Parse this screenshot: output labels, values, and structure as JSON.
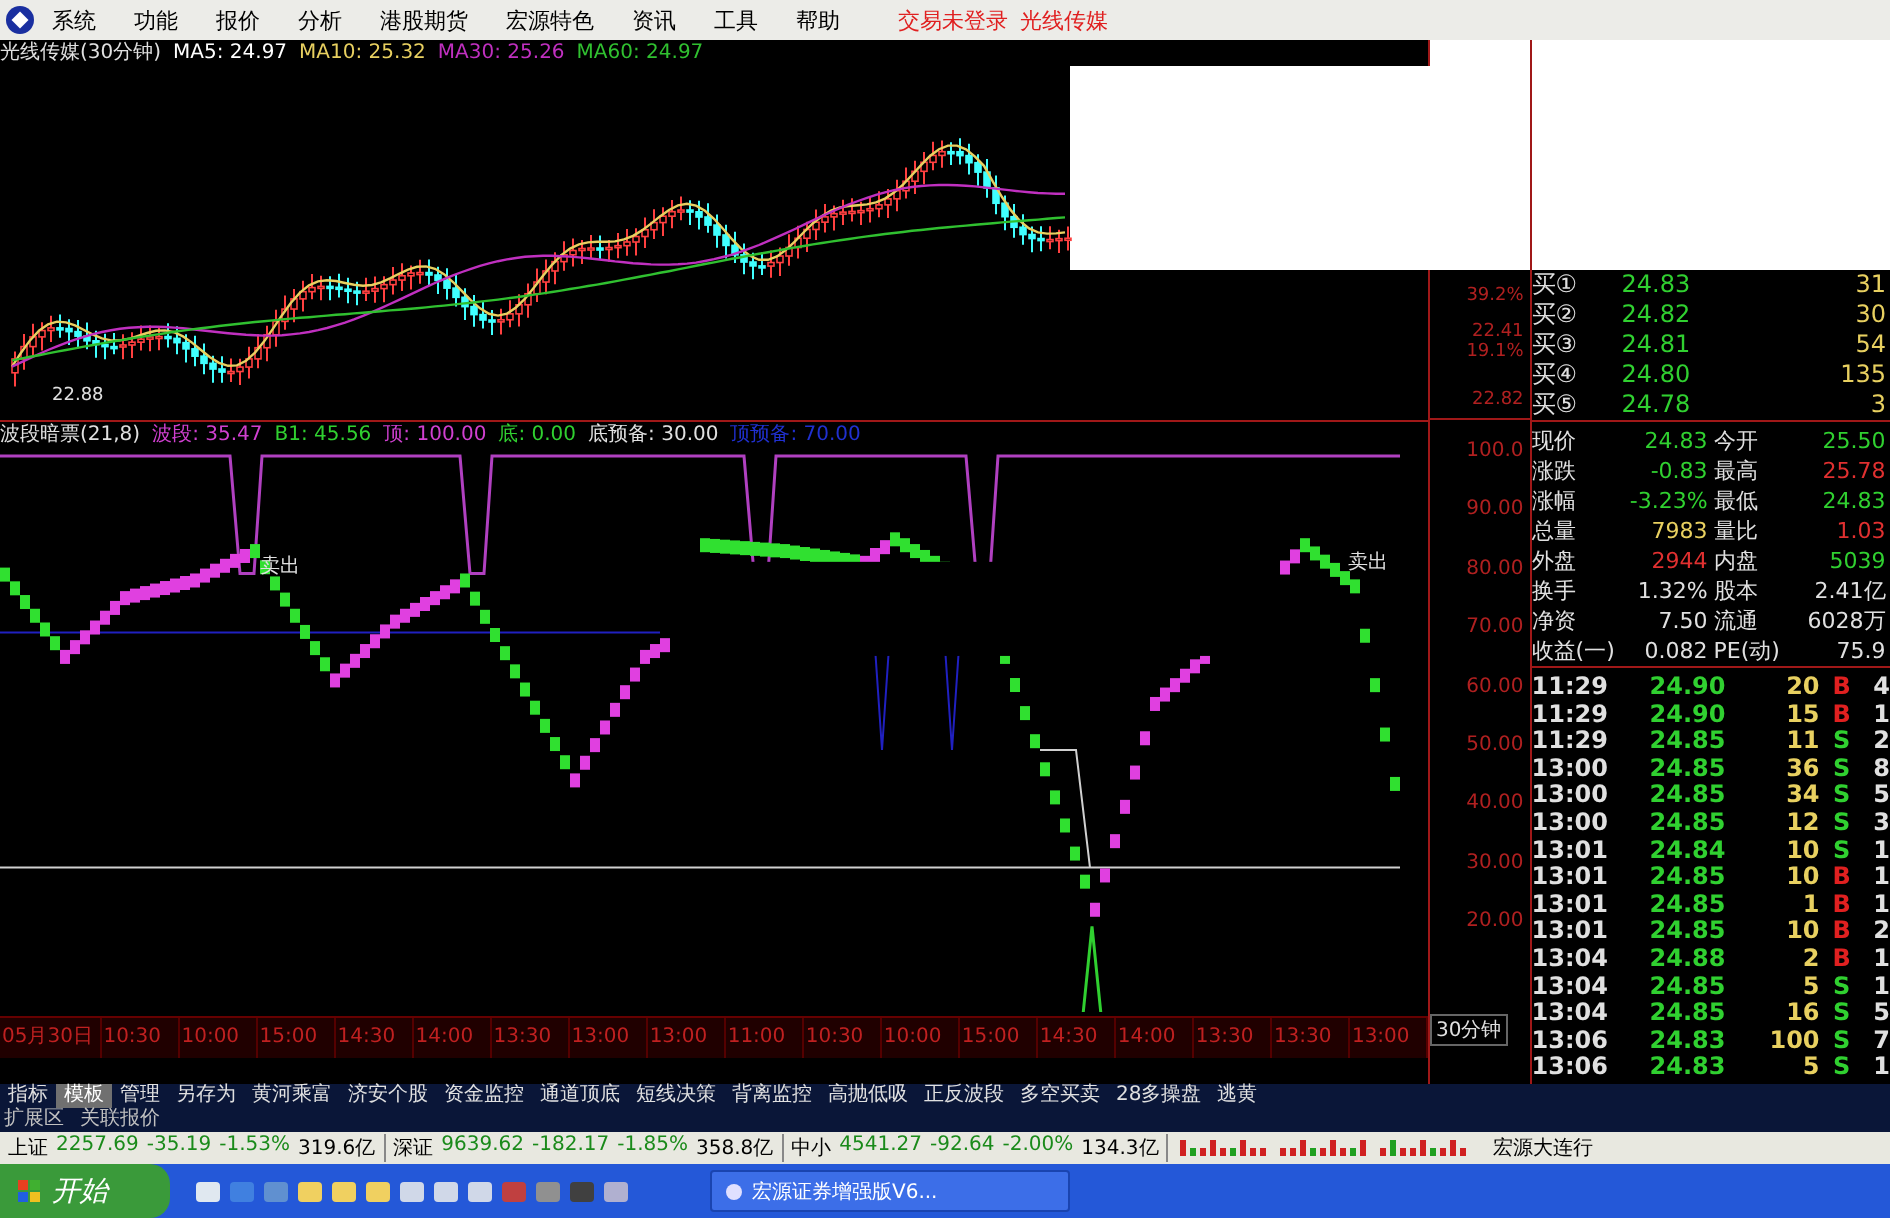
{
  "menu": {
    "items": [
      "系统",
      "功能",
      "报价",
      "分析",
      "港股期货",
      "宏源特色",
      "资讯",
      "工具",
      "帮助"
    ],
    "status": [
      "交易未登录",
      "光线传媒"
    ]
  },
  "price_chart": {
    "title": "光线传媒(30分钟)",
    "ma": [
      {
        "label": "MA5: 24.97",
        "color": "#ffffff"
      },
      {
        "label": "MA10: 25.32",
        "color": "#e8d060"
      },
      {
        "label": "MA30: 25.26",
        "color": "#c030c0"
      },
      {
        "label": "MA60: 24.97",
        "color": "#30c030"
      }
    ],
    "low_label": "22.88",
    "axis": [
      "39.2%",
      "22.41",
      "19.1%",
      "22.82"
    ]
  },
  "indicator": {
    "title": "波段暗票(21,8)",
    "values": [
      {
        "label": "波段: 35.47",
        "color": "#d040d0"
      },
      {
        "label": "B1: 45.56",
        "color": "#30d030"
      },
      {
        "label": "顶: 100.00",
        "color": "#d040d0"
      },
      {
        "label": "底: 0.00",
        "color": "#30d030"
      },
      {
        "label": "底预备: 30.00",
        "color": "#e0e0e0"
      },
      {
        "label": "顶预备: 70.00",
        "color": "#2030d0"
      }
    ],
    "annotations": [
      "卖出",
      "卖出"
    ],
    "axis": [
      "100.0",
      "90.00",
      "80.00",
      "70.00",
      "60.00",
      "50.00",
      "40.00",
      "30.00",
      "20.00"
    ]
  },
  "time_axis": [
    "05月30日",
    "10:30",
    "10:00",
    "15:00",
    "14:30",
    "14:00",
    "13:30",
    "13:00",
    "13:00",
    "11:00",
    "10:30",
    "10:00",
    "15:00",
    "14:30",
    "14:00",
    "13:30",
    "13:30",
    "13:00"
  ],
  "period": "30分钟",
  "order_book": [
    {
      "label": "买①",
      "price": "24.83",
      "volume": "31"
    },
    {
      "label": "买②",
      "price": "24.82",
      "volume": "30"
    },
    {
      "label": "买③",
      "price": "24.81",
      "volume": "54"
    },
    {
      "label": "买④",
      "price": "24.80",
      "volume": "135"
    },
    {
      "label": "买⑤",
      "price": "24.78",
      "volume": "3"
    }
  ],
  "stats": [
    {
      "cells": [
        {
          "label": "现价",
          "value": "24.83",
          "color": "#30d030"
        },
        {
          "label": "今开",
          "value": "25.50",
          "color": "#30d030"
        }
      ]
    },
    {
      "cells": [
        {
          "label": "涨跌",
          "value": "-0.83",
          "color": "#30d030"
        },
        {
          "label": "最高",
          "value": "25.78",
          "color": "#e03030"
        }
      ]
    },
    {
      "cells": [
        {
          "label": "涨幅",
          "value": "-3.23%",
          "color": "#30d030"
        },
        {
          "label": "最低",
          "value": "24.83",
          "color": "#30d030"
        }
      ]
    },
    {
      "cells": [
        {
          "label": "总量",
          "value": "7983",
          "color": "#e8d060"
        },
        {
          "label": "量比",
          "value": "1.03",
          "color": "#e03030"
        }
      ]
    },
    {
      "cells": [
        {
          "label": "外盘",
          "value": "2944",
          "color": "#e03030"
        },
        {
          "label": "内盘",
          "value": "5039",
          "color": "#30d030"
        }
      ]
    },
    {
      "cells": [
        {
          "label": "换手",
          "value": "1.32%",
          "color": "#e0e0e0"
        },
        {
          "label": "股本",
          "value": "2.41亿",
          "color": "#e0e0e0"
        }
      ]
    },
    {
      "cells": [
        {
          "label": "净资",
          "value": "7.50",
          "color": "#e0e0e0"
        },
        {
          "label": "流通",
          "value": "6028万",
          "color": "#e0e0e0"
        }
      ]
    },
    {
      "cells": [
        {
          "label": "收益(一)",
          "value": "0.082",
          "color": "#e0e0e0"
        },
        {
          "label": "PE(动)",
          "value": "75.9",
          "color": "#e0e0e0"
        }
      ]
    }
  ],
  "ticks": [
    {
      "time": "11:29",
      "price": "24.90",
      "volume": "20",
      "side": "B",
      "kind": "buy",
      "column_5": "4"
    },
    {
      "time": "11:29",
      "price": "24.90",
      "volume": "15",
      "side": "B",
      "kind": "buy",
      "column_5": "1"
    },
    {
      "time": "11:29",
      "price": "24.85",
      "volume": "11",
      "side": "S",
      "kind": "sell",
      "column_5": "2"
    },
    {
      "time": "13:00",
      "price": "24.85",
      "volume": "36",
      "side": "S",
      "kind": "sell",
      "column_5": "8"
    },
    {
      "time": "13:00",
      "price": "24.85",
      "volume": "34",
      "side": "S",
      "kind": "sell",
      "column_5": "5"
    },
    {
      "time": "13:00",
      "price": "24.85",
      "volume": "12",
      "side": "S",
      "kind": "sell",
      "column_5": "3"
    },
    {
      "time": "13:01",
      "price": "24.84",
      "volume": "10",
      "side": "S",
      "kind": "sell",
      "column_5": "1"
    },
    {
      "time": "13:01",
      "price": "24.85",
      "volume": "10",
      "side": "B",
      "kind": "buy",
      "column_5": "1"
    },
    {
      "time": "13:01",
      "price": "24.85",
      "volume": "1",
      "side": "B",
      "kind": "buy",
      "column_5": "1"
    },
    {
      "time": "13:01",
      "price": "24.85",
      "volume": "10",
      "side": "B",
      "kind": "buy",
      "column_5": "2"
    },
    {
      "time": "13:04",
      "price": "24.88",
      "volume": "2",
      "side": "B",
      "kind": "buy",
      "column_5": "1"
    },
    {
      "time": "13:04",
      "price": "24.85",
      "volume": "5",
      "side": "S",
      "kind": "sell",
      "column_5": "1"
    },
    {
      "time": "13:04",
      "price": "24.85",
      "volume": "16",
      "side": "S",
      "kind": "sell",
      "column_5": "5"
    },
    {
      "time": "13:06",
      "price": "24.83",
      "volume": "100",
      "side": "S",
      "kind": "sell",
      "column_5": "7"
    },
    {
      "time": "13:06",
      "price": "24.83",
      "volume": "5",
      "side": "S",
      "kind": "sell",
      "column_5": "1"
    }
  ],
  "tabs": [
    {
      "label": "指标",
      "selected": false
    },
    {
      "label": "模板",
      "selected": true
    },
    {
      "label": "管理",
      "selected": false
    },
    {
      "label": "另存为",
      "selected": false
    },
    {
      "label": "黄河乘富",
      "selected": false
    },
    {
      "label": "济安个股",
      "selected": false
    },
    {
      "label": "资金监控",
      "selected": false
    },
    {
      "label": "通道顶底",
      "selected": false
    },
    {
      "label": "短线决策",
      "selected": false
    },
    {
      "label": "背离监控",
      "selected": false
    },
    {
      "label": "高抛低吸",
      "selected": false
    },
    {
      "label": "正反波段",
      "selected": false
    },
    {
      "label": "多空买卖",
      "selected": false
    },
    {
      "label": "28多操盘",
      "selected": false
    },
    {
      "label": "逃黄",
      "selected": false
    }
  ],
  "extension_bar": [
    "扩展区",
    "关联报价"
  ],
  "status_bar": {
    "indices": [
      {
        "name": "上证",
        "value": "2257.69",
        "change": "-35.19",
        "percent": "-1.53%",
        "amount": "319.6亿"
      },
      {
        "name": "深证",
        "value": "9639.62",
        "change": "-182.17",
        "percent": "-1.85%",
        "amount": "358.8亿"
      },
      {
        "name": "中小",
        "value": "4541.27",
        "change": "-92.64",
        "percent": "-2.00%",
        "amount": "134.3亿"
      }
    ],
    "ticker": "宏源大连行"
  },
  "taskbar": {
    "start": "开始",
    "tasks": [
      "宏源证券增强版V6..."
    ]
  }
}
